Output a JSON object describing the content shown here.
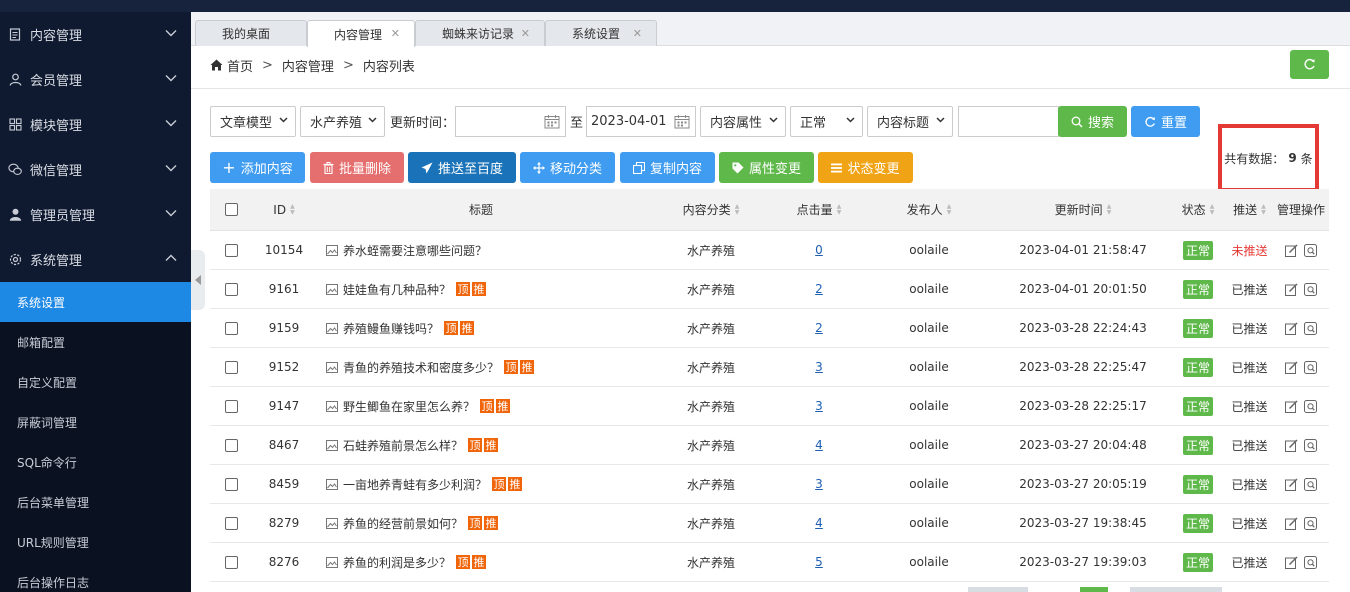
{
  "sidebar": {
    "menus": [
      {
        "label": "内容管理",
        "icon": "document-icon",
        "expanded": false
      },
      {
        "label": "会员管理",
        "icon": "user-icon",
        "expanded": false
      },
      {
        "label": "模块管理",
        "icon": "grid-icon",
        "expanded": false
      },
      {
        "label": "微信管理",
        "icon": "wechat-icon",
        "expanded": false
      },
      {
        "label": "管理员管理",
        "icon": "admin-icon",
        "expanded": false
      },
      {
        "label": "系统管理",
        "icon": "gear-icon",
        "expanded": true
      }
    ],
    "submenu": [
      "系统设置",
      "邮箱配置",
      "自定义配置",
      "屏蔽词管理",
      "SQL命令行",
      "后台菜单管理",
      "URL规则管理",
      "后台操作日志"
    ],
    "active_sub": "系统设置"
  },
  "tabs": [
    {
      "label": "我的桌面",
      "active": false,
      "closable": false
    },
    {
      "label": "内容管理",
      "active": true,
      "closable": true
    },
    {
      "label": "蜘蛛来访记录",
      "active": false,
      "closable": true
    },
    {
      "label": "系统设置",
      "active": false,
      "closable": true
    }
  ],
  "breadcrumb": {
    "home": "首页",
    "sep": ">",
    "level1": "内容管理",
    "level2": "内容列表"
  },
  "filters": {
    "model": "文章模型",
    "category": "水产养殖",
    "update_time_label": "更新时间：",
    "date_from": "",
    "to_label": "至",
    "date_to": "2023-04-01",
    "attribute": "内容属性",
    "status": "正常",
    "field": "内容标题",
    "keyword": "",
    "search_label": "搜索",
    "reset_label": "重置"
  },
  "toolbar": {
    "add": "添加内容",
    "batch_delete": "批量删除",
    "push_baidu": "推送至百度",
    "move_category": "移动分类",
    "copy_content": "复制内容",
    "attr_change": "属性变更",
    "status_change": "状态变更"
  },
  "total": {
    "prefix": "共有数据：",
    "count": "9",
    "suffix": "条"
  },
  "colors": {
    "green": "#5fb84a",
    "blue": "#3f9cf0",
    "red": "#e56e6e",
    "teal": "#1a73b8",
    "orange": "#f0a315",
    "tag": "#f0640a"
  },
  "table": {
    "headers": {
      "id": "ID",
      "title": "标题",
      "category": "内容分类",
      "hits": "点击量",
      "publisher": "发布人",
      "updated": "更新时间",
      "status": "状态",
      "push": "推送",
      "ops": "管理操作"
    },
    "tag_top": "顶",
    "tag_push": "推",
    "rows": [
      {
        "id": "10154",
        "title": "养水蛭需要注意哪些问题？",
        "tags": false,
        "category": "水产养殖",
        "hits": "0",
        "publisher": "oolaile",
        "updated": "2023-04-01 21:58:47",
        "status": "正常",
        "push": "未推送"
      },
      {
        "id": "9161",
        "title": "娃娃鱼有几种品种？",
        "tags": true,
        "category": "水产养殖",
        "hits": "2",
        "publisher": "oolaile",
        "updated": "2023-04-01 20:01:50",
        "status": "正常",
        "push": "已推送"
      },
      {
        "id": "9159",
        "title": "养殖鳗鱼赚钱吗？",
        "tags": true,
        "category": "水产养殖",
        "hits": "2",
        "publisher": "oolaile",
        "updated": "2023-03-28 22:24:43",
        "status": "正常",
        "push": "已推送"
      },
      {
        "id": "9152",
        "title": "青鱼的养殖技术和密度多少？",
        "tags": true,
        "category": "水产养殖",
        "hits": "3",
        "publisher": "oolaile",
        "updated": "2023-03-28 22:25:47",
        "status": "正常",
        "push": "已推送"
      },
      {
        "id": "9147",
        "title": "野生鲫鱼在家里怎么养？",
        "tags": true,
        "category": "水产养殖",
        "hits": "3",
        "publisher": "oolaile",
        "updated": "2023-03-28 22:25:17",
        "status": "正常",
        "push": "已推送"
      },
      {
        "id": "8467",
        "title": "石蛙养殖前景怎么样？",
        "tags": true,
        "category": "水产养殖",
        "hits": "4",
        "publisher": "oolaile",
        "updated": "2023-03-27 20:04:48",
        "status": "正常",
        "push": "已推送"
      },
      {
        "id": "8459",
        "title": "一亩地养青蛙有多少利润？",
        "tags": true,
        "category": "水产养殖",
        "hits": "3",
        "publisher": "oolaile",
        "updated": "2023-03-27 20:05:19",
        "status": "正常",
        "push": "已推送"
      },
      {
        "id": "8279",
        "title": "养鱼的经营前景如何？",
        "tags": true,
        "category": "水产养殖",
        "hits": "4",
        "publisher": "oolaile",
        "updated": "2023-03-27 19:38:45",
        "status": "正常",
        "push": "已推送"
      },
      {
        "id": "8276",
        "title": "养鱼的利润是多少？",
        "tags": true,
        "category": "水产养殖",
        "hits": "5",
        "publisher": "oolaile",
        "updated": "2023-03-27 19:39:03",
        "status": "正常",
        "push": "已推送"
      }
    ]
  }
}
